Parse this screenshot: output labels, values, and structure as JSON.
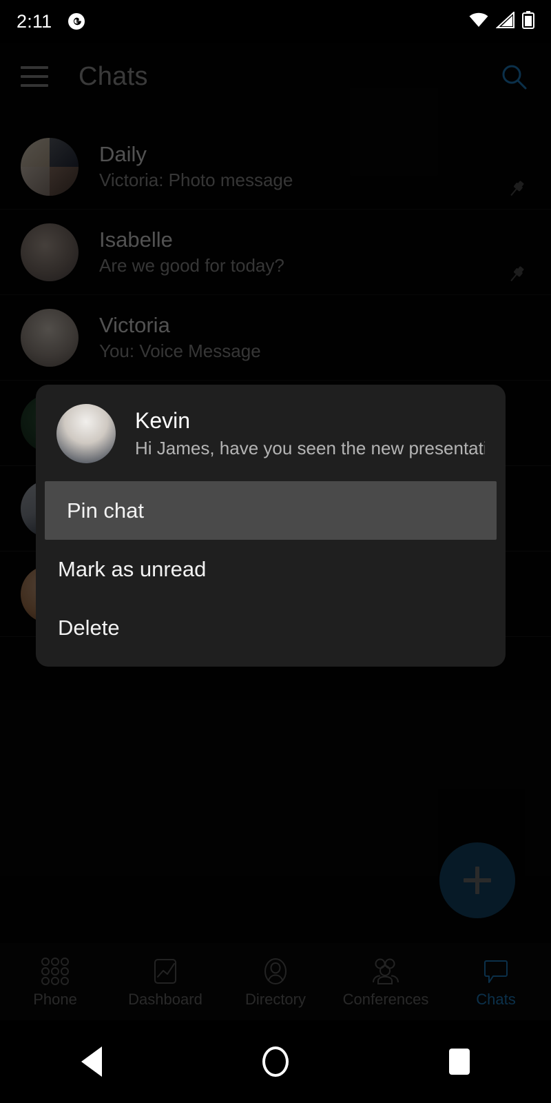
{
  "status_bar": {
    "time": "2:11",
    "notification_icon": "g-app-icon",
    "wifi_icon": "wifi-icon",
    "signal_icon": "cellular-signal-icon",
    "battery_icon": "battery-icon"
  },
  "app_bar": {
    "menu_icon": "hamburger-menu-icon",
    "title": "Chats",
    "search_icon": "search-icon",
    "accent_color": "#1e7fc2"
  },
  "chats": [
    {
      "name": "Daily",
      "preview": "Victoria: Photo message",
      "pinned": true,
      "avatar_type": "group-quad",
      "avatar_colors": [
        "#cfc3b0",
        "#2f3a4a",
        "#b9b0a8",
        "#5b4a44"
      ]
    },
    {
      "name": "Isabelle",
      "preview": "Are we good for today?",
      "pinned": true,
      "avatar_type": "photo",
      "avatar_colors": [
        "#9a8f88",
        "#6a5f5a"
      ]
    },
    {
      "name": "Victoria",
      "preview": "You: Voice Message",
      "pinned": false,
      "avatar_type": "photo",
      "avatar_colors": [
        "#c6bdb3",
        "#7e736c"
      ]
    }
  ],
  "hidden_chats": [
    {
      "avatar_colors": [
        "#20402c",
        "#17301f"
      ]
    },
    {
      "avatar_colors": [
        "#8b9099",
        "#2c3647"
      ]
    },
    {
      "avatar_colors": [
        "#c09a7e",
        "#6a4a38"
      ]
    }
  ],
  "context_menu": {
    "chat": {
      "name": "Kevin",
      "preview": "Hi James, have you seen the new presentatio...",
      "avatar_colors": [
        "#e8e6e2",
        "#26303f"
      ]
    },
    "items": [
      {
        "label": "Pin chat",
        "highlighted": true
      },
      {
        "label": "Mark as unread",
        "highlighted": false
      },
      {
        "label": "Delete",
        "highlighted": false
      }
    ],
    "background_color": "#1f1f1f",
    "highlight_color": "#4a4a4a"
  },
  "fab": {
    "icon": "plus-icon",
    "background_color": "#134466"
  },
  "bottom_nav": {
    "items": [
      {
        "label": "Phone",
        "icon": "dialpad-icon",
        "active": false
      },
      {
        "label": "Dashboard",
        "icon": "chart-icon",
        "active": false
      },
      {
        "label": "Directory",
        "icon": "person-icon",
        "active": false
      },
      {
        "label": "Conferences",
        "icon": "people-group-icon",
        "active": false
      },
      {
        "label": "Chats",
        "icon": "chat-bubble-icon",
        "active": true
      }
    ],
    "active_color": "#1e7fc2",
    "inactive_color": "#6d6d6d"
  },
  "system_nav": {
    "back": "back-triangle-icon",
    "home": "home-circle-icon",
    "recents": "recents-square-icon"
  }
}
